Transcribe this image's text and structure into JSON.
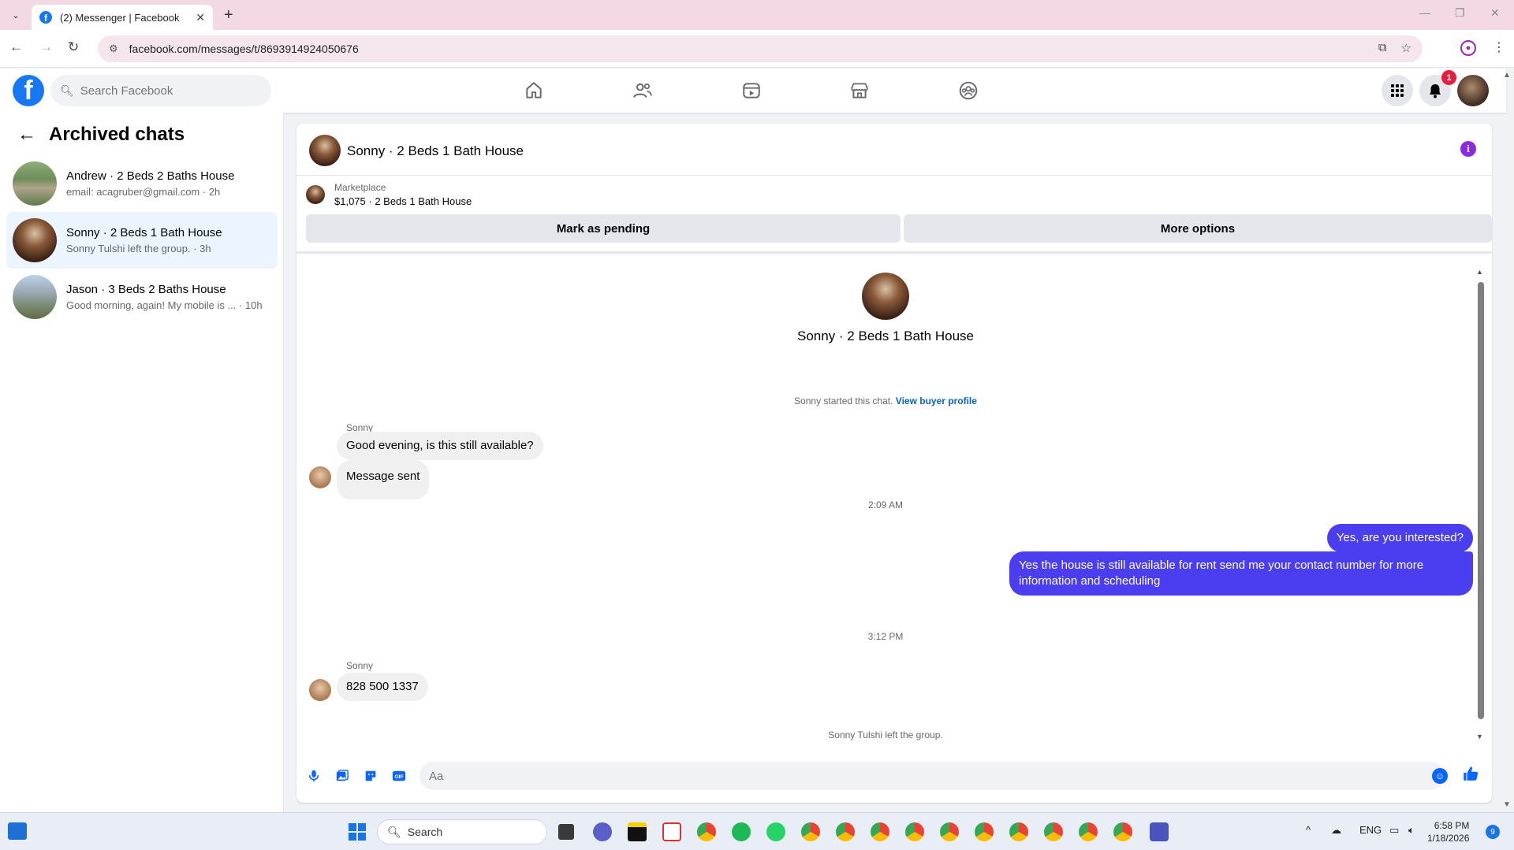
{
  "browser": {
    "tab_title": "(2) Messenger | Facebook",
    "url": "facebook.com/messages/t/8693914924050676"
  },
  "fb_header": {
    "search_placeholder": "Search Facebook",
    "notification_count": "1",
    "nav_icons": [
      "home-icon",
      "friends-icon",
      "video-icon",
      "marketplace-icon",
      "groups-icon"
    ]
  },
  "sidebar": {
    "title": "Archived chats",
    "chats": [
      {
        "name": "Andrew · 2 Beds 2 Baths House",
        "preview": "email: acagruber@gmail.com · 2h"
      },
      {
        "name": "Sonny · 2 Beds 1 Bath House",
        "preview": "Sonny Tulshi left the group. · 3h"
      },
      {
        "name": "Jason · 3 Beds 2 Baths House",
        "preview": "Good morning, again! My mobile is ...  · 10h"
      }
    ]
  },
  "conversation": {
    "title": "Sonny · 2 Beds 1 Bath House",
    "marketplace_label": "Marketplace",
    "listing": "$1,075 · 2 Beds 1 Bath House",
    "mark_pending": "Mark as pending",
    "more_options": "More options",
    "profile_name": "Sonny · 2 Beds 1 Bath House",
    "started_text": "Sonny started this chat.",
    "view_buyer": "View buyer profile",
    "messages": [
      {
        "sender": "Sonny",
        "text": "Good evening, is this still available?"
      },
      {
        "text": "Message sent"
      },
      {
        "timestamp": "2:09 AM"
      },
      {
        "text": "Yes, are you interested?"
      },
      {
        "text": "Yes the house is still available for rent send me your contact number for more information and scheduling"
      },
      {
        "timestamp": "3:12 PM"
      },
      {
        "sender": "Sonny",
        "text": "828 500 1337"
      }
    ],
    "left_notice": "Sonny Tulshi left the group.",
    "composer_placeholder": "Aa"
  },
  "taskbar": {
    "search_label": "Search",
    "lang": "ENG",
    "time": "6:58 PM",
    "date": "1/18/2026",
    "notif_count": "9"
  },
  "colors": {
    "brand": "#1877f2",
    "outgoing_bubble": "#4b3ef0",
    "active_chat_bg": "#ebf5ff",
    "info_icon": "#8a2be2"
  }
}
